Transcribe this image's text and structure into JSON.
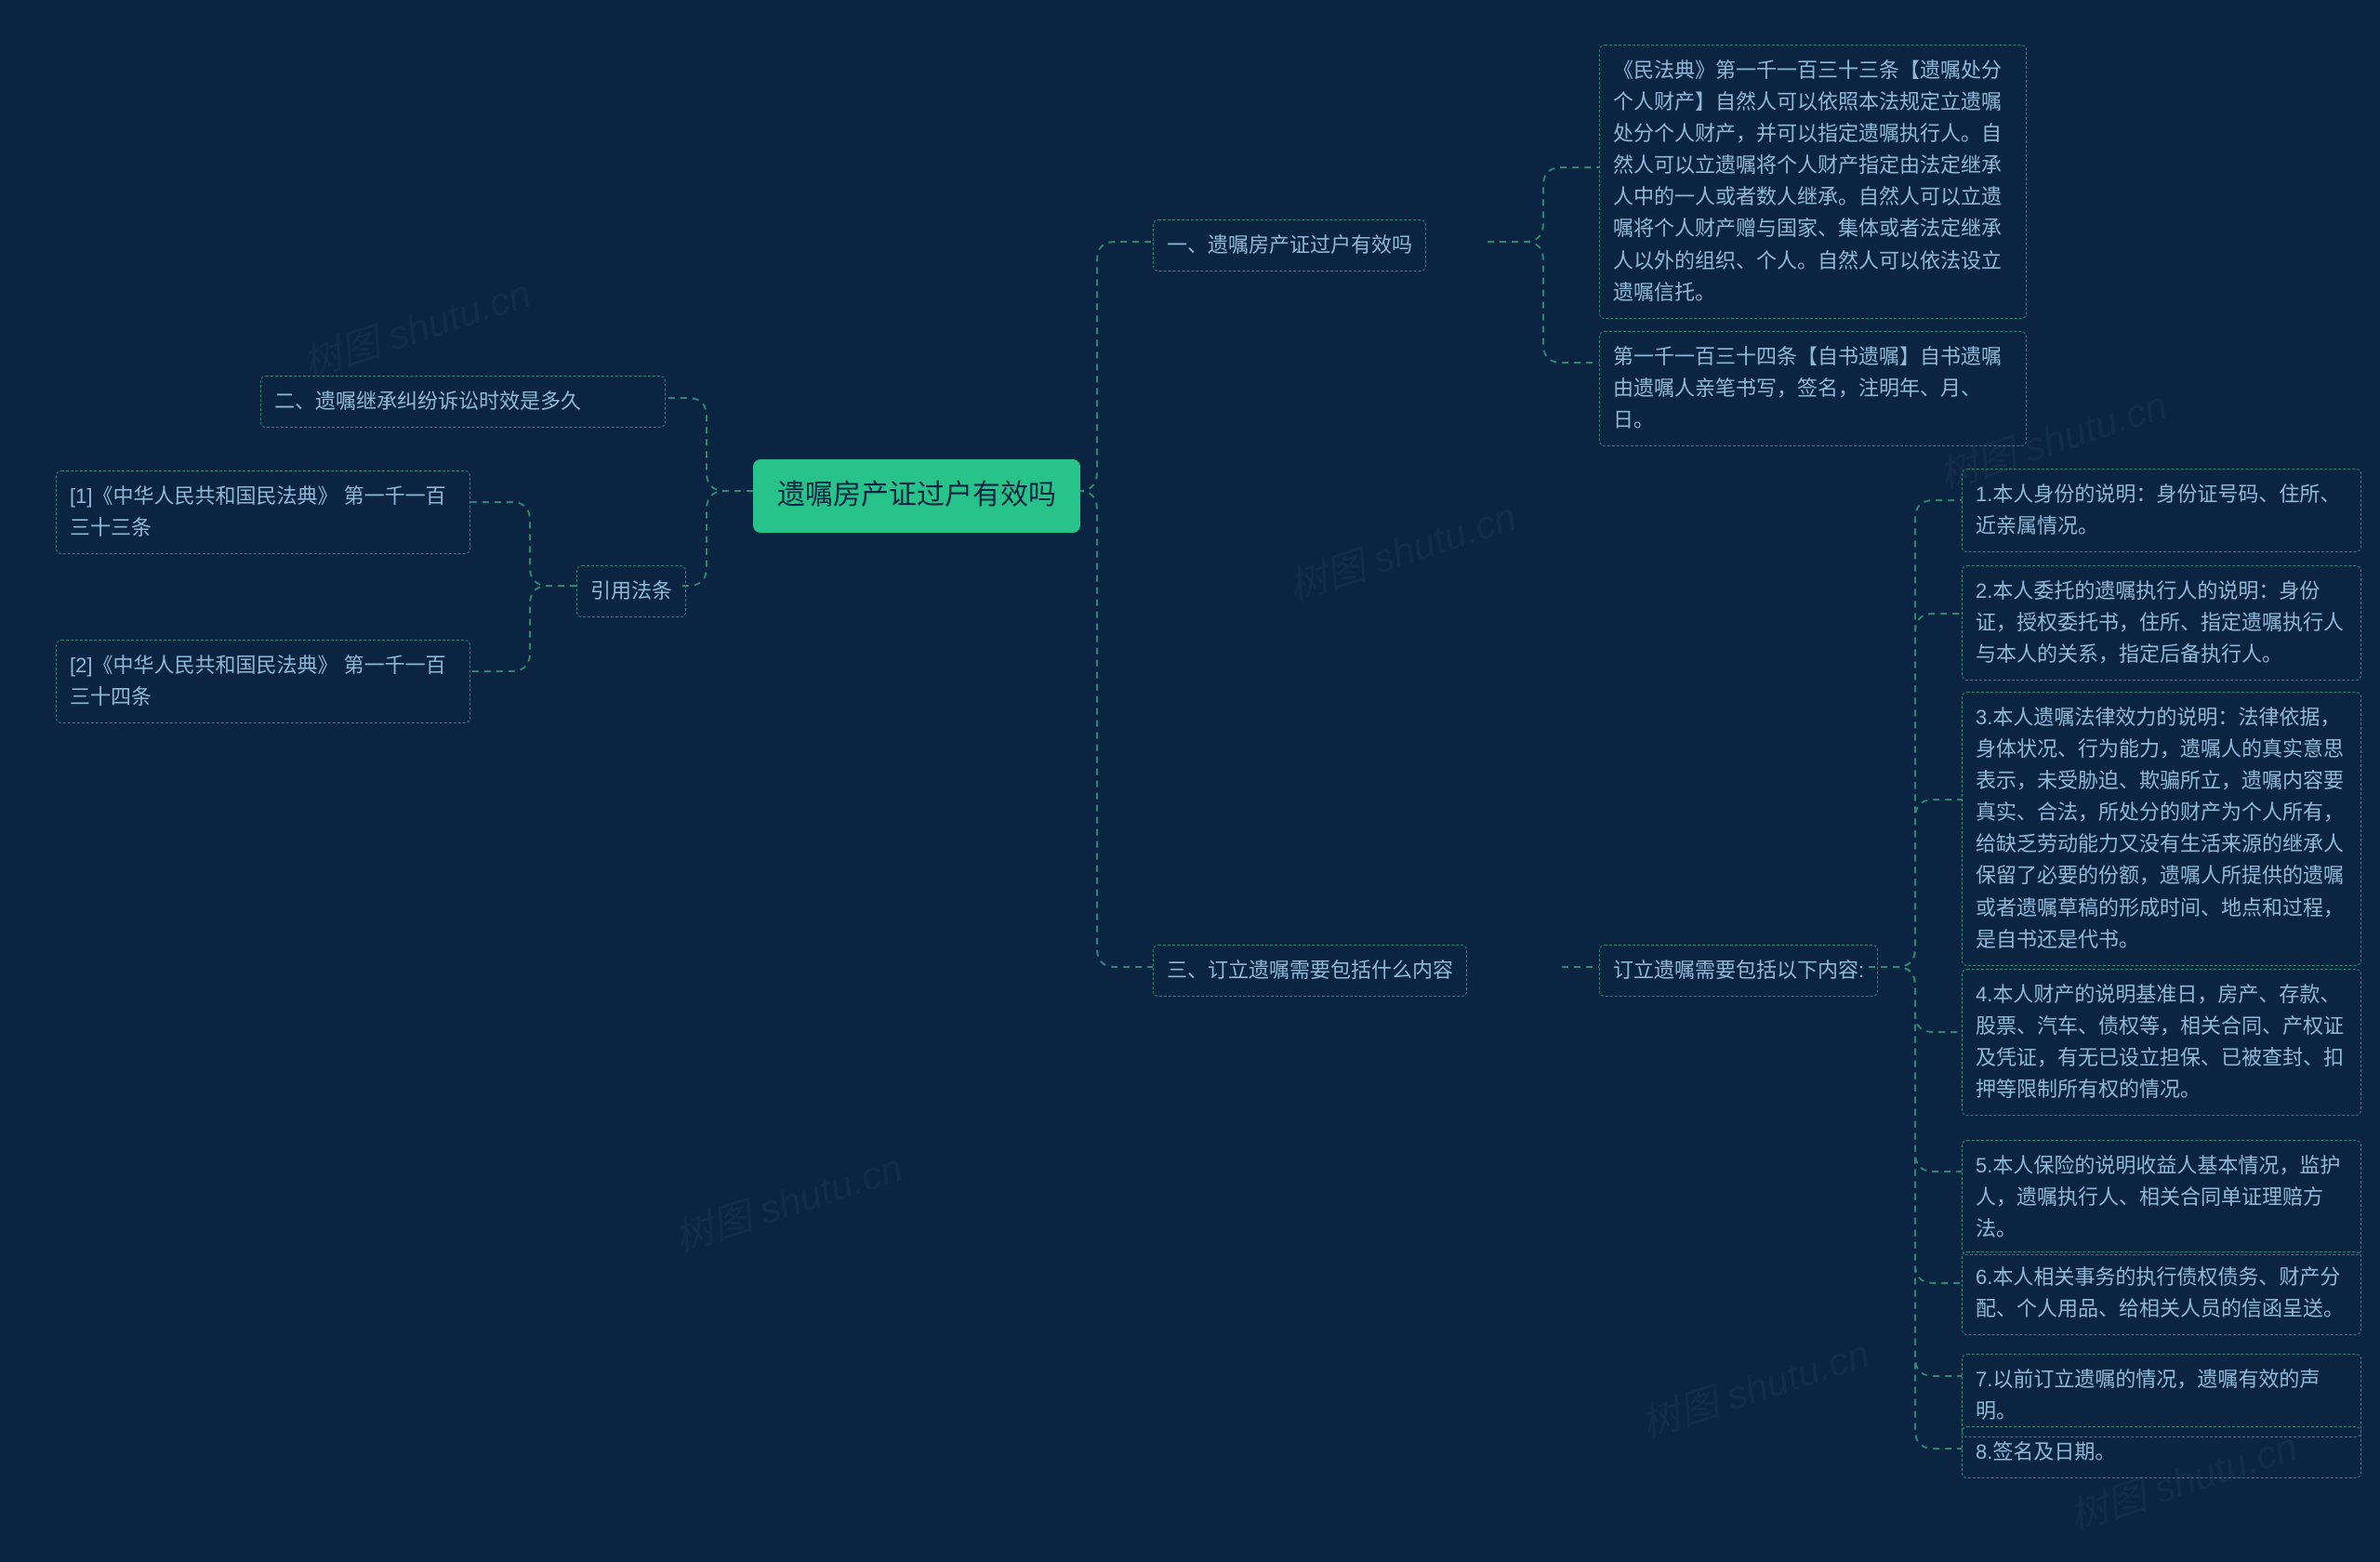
{
  "root": {
    "label": "遗嘱房产证过户有效吗"
  },
  "left_branches": {
    "b1": {
      "label": "二、遗嘱继承纠纷诉讼时效是多久"
    },
    "b2": {
      "label": "引用法条",
      "children": {
        "c1": "[1]《中华人民共和国民法典》 第一千一百三十三条",
        "c2": "[2]《中华人民共和国民法典》 第一千一百三十四条"
      }
    }
  },
  "right_branches": {
    "r1": {
      "label": "一、遗嘱房产证过户有效吗",
      "children": {
        "c1": "《民法典》第一千一百三十三条【遗嘱处分个人财产】自然人可以依照本法规定立遗嘱处分个人财产，并可以指定遗嘱执行人。自然人可以立遗嘱将个人财产指定由法定继承人中的一人或者数人继承。自然人可以立遗嘱将个人财产赠与国家、集体或者法定继承人以外的组织、个人。自然人可以依法设立遗嘱信托。",
        "c2": "第一千一百三十四条【自书遗嘱】自书遗嘱由遗嘱人亲笔书写，签名，注明年、月、日。"
      }
    },
    "r2": {
      "label": "三、订立遗嘱需要包括什么内容",
      "mid": {
        "label": "订立遗嘱需要包括以下内容:"
      },
      "children": {
        "d1": "1.本人身份的说明：身份证号码、住所、近亲属情况。",
        "d2": "2.本人委托的遗嘱执行人的说明：身份证，授权委托书，住所、指定遗嘱执行人与本人的关系，指定后备执行人。",
        "d3": "3.本人遗嘱法律效力的说明：法律依据，身体状况、行为能力，遗嘱人的真实意思表示，未受胁迫、欺骗所立，遗嘱内容要真实、合法，所处分的财产为个人所有，给缺乏劳动能力又没有生活来源的继承人保留了必要的份额，遗嘱人所提供的遗嘱或者遗嘱草稿的形成时间、地点和过程，是自书还是代书。",
        "d4": "4.本人财产的说明基准日，房产、存款、股票、汽车、债权等，相关合同、产权证及凭证，有无已设立担保、已被查封、扣押等限制所有权的情况。",
        "d5": "5.本人保险的说明收益人基本情况，监护人，遗嘱执行人、相关合同单证理赔方法。",
        "d6": "6.本人相关事务的执行债权债务、财产分配、个人用品、给相关人员的信函呈送。",
        "d7": "7.以前订立遗嘱的情况，遗嘱有效的声明。",
        "d8": "8.签名及日期。"
      }
    }
  },
  "watermark": "树图 shutu.cn"
}
